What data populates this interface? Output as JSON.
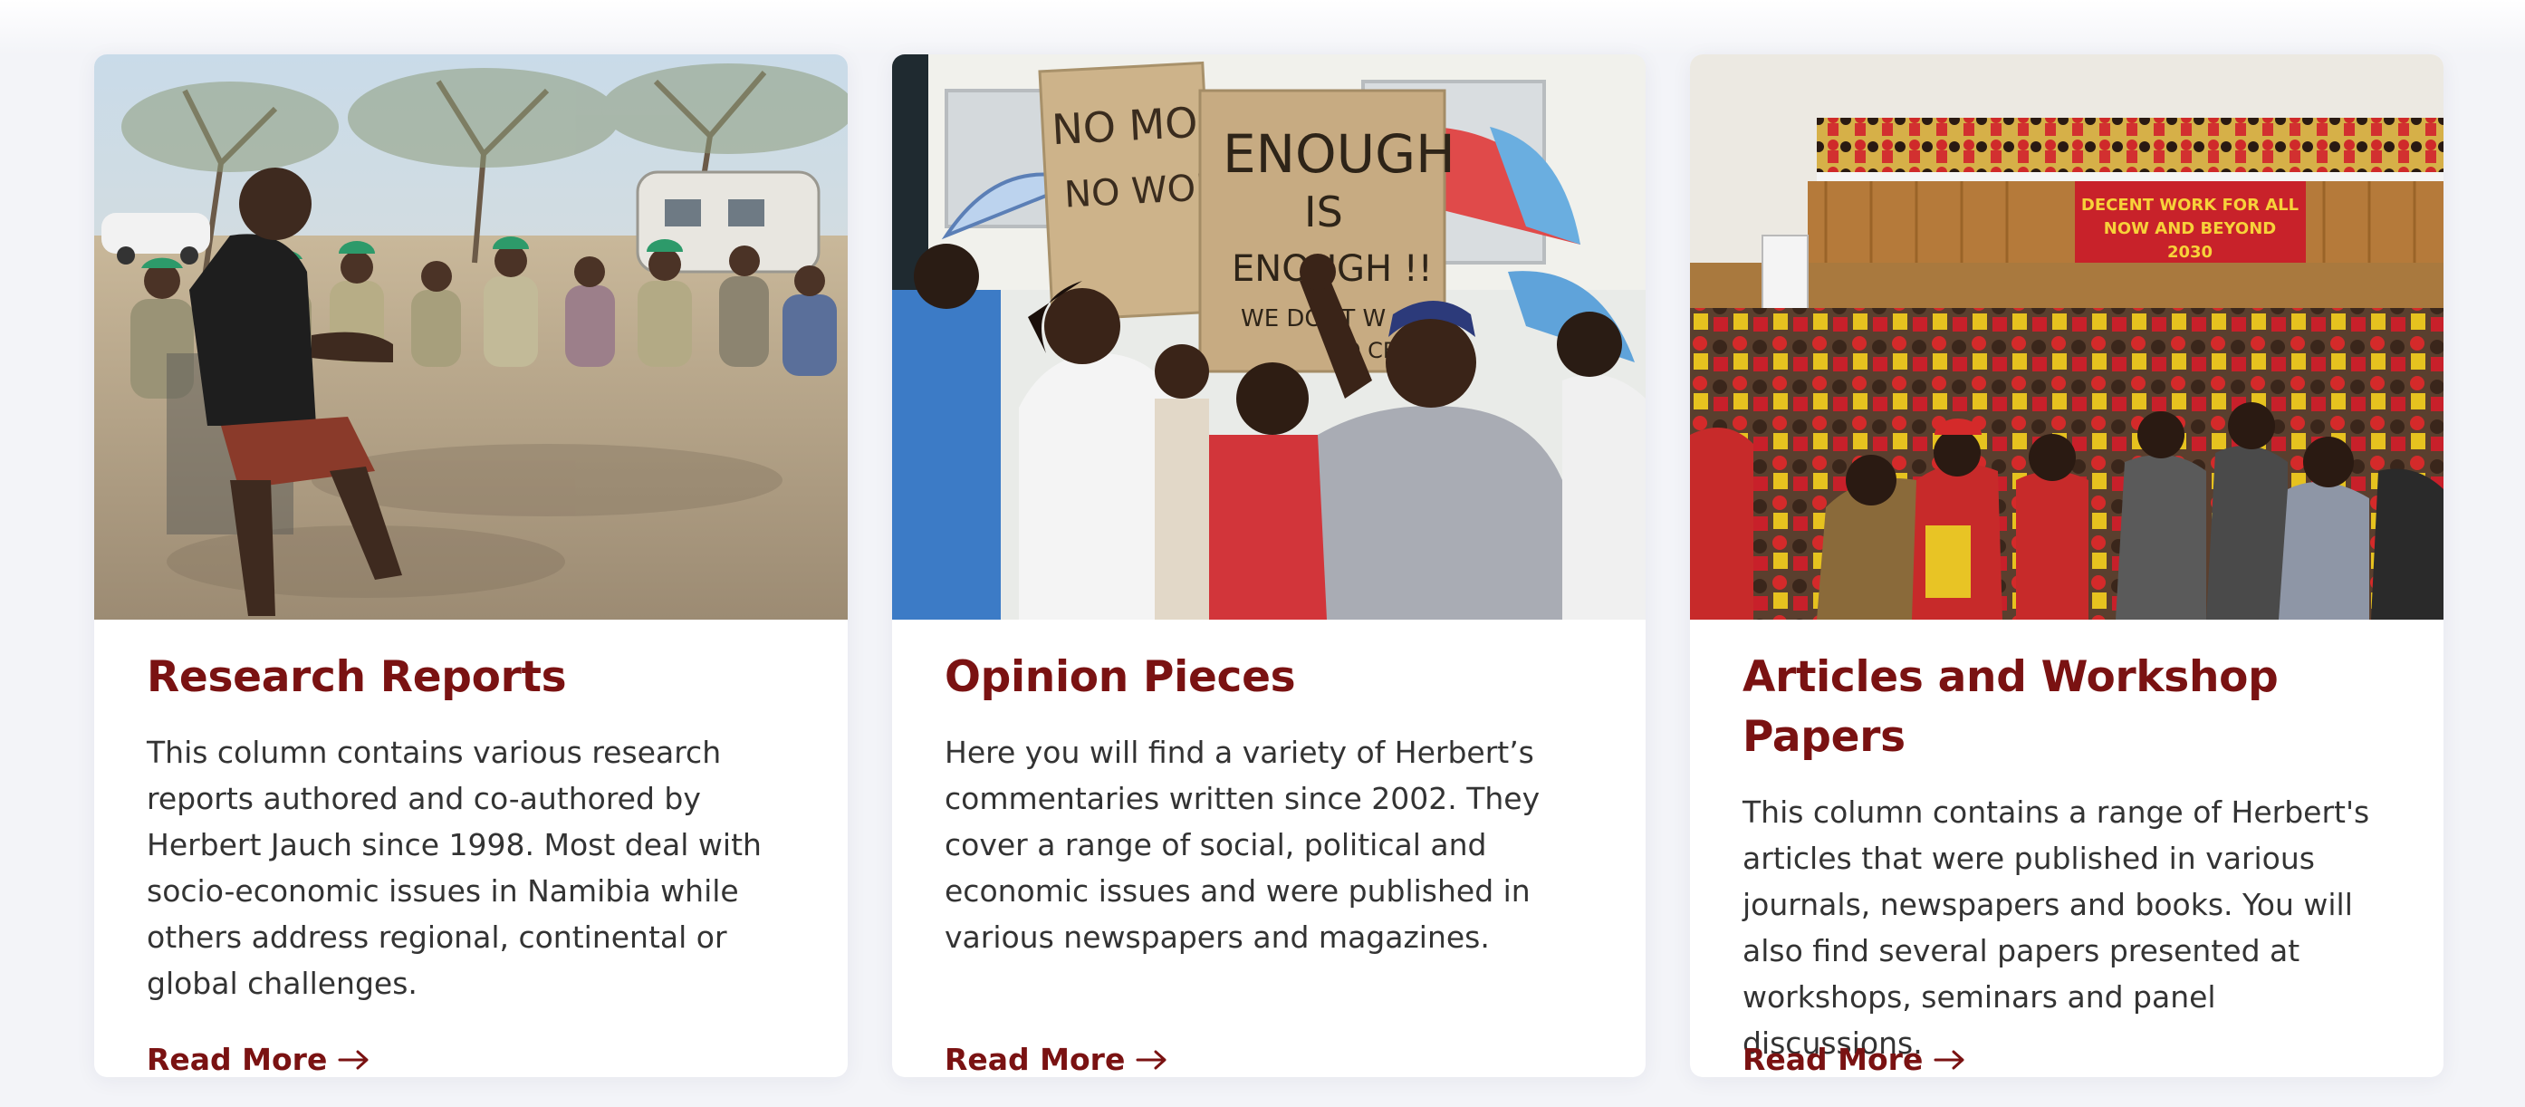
{
  "cards": [
    {
      "title": "Research Reports",
      "description": "This column contains various research reports authored and co-authored by Herbert Jauch since 1998. Most deal with socio-economic issues in Namibia while others address regional, continental or global challenges.",
      "link_label": "Read More",
      "image_icon": "workers-meeting-photo"
    },
    {
      "title": "Opinion Pieces",
      "description": "Here you will find a variety of Herbert’s commentaries written since 2002. They cover a range of social, political and economic issues and were published in various newspapers and magazines.",
      "link_label": "Read More",
      "image_icon": "protest-march-photo",
      "sign_texts": [
        "NO MONEY",
        "NO WORK",
        "ENOUGH",
        "IS",
        "ENOUGH !!",
        "WE DONT W",
        "GO CE"
      ]
    },
    {
      "title": "Articles and Workshop Papers",
      "description": "This column contains a range of Herbert's articles that were published in various journals, newspapers and books. You will also find several papers presented at workshops, seminars and panel discussions.",
      "link_label": "Read More",
      "image_icon": "union-congress-photo",
      "banner_texts": [
        "DECENT WORK FOR ALL",
        "NOW AND BEYOND",
        "2030"
      ]
    }
  ],
  "colors": {
    "accent": "#7a1212",
    "text": "#333333",
    "background": "#f3f4f8",
    "card": "#ffffff"
  },
  "icons": {
    "read_more_arrow": "arrow-right-icon"
  }
}
